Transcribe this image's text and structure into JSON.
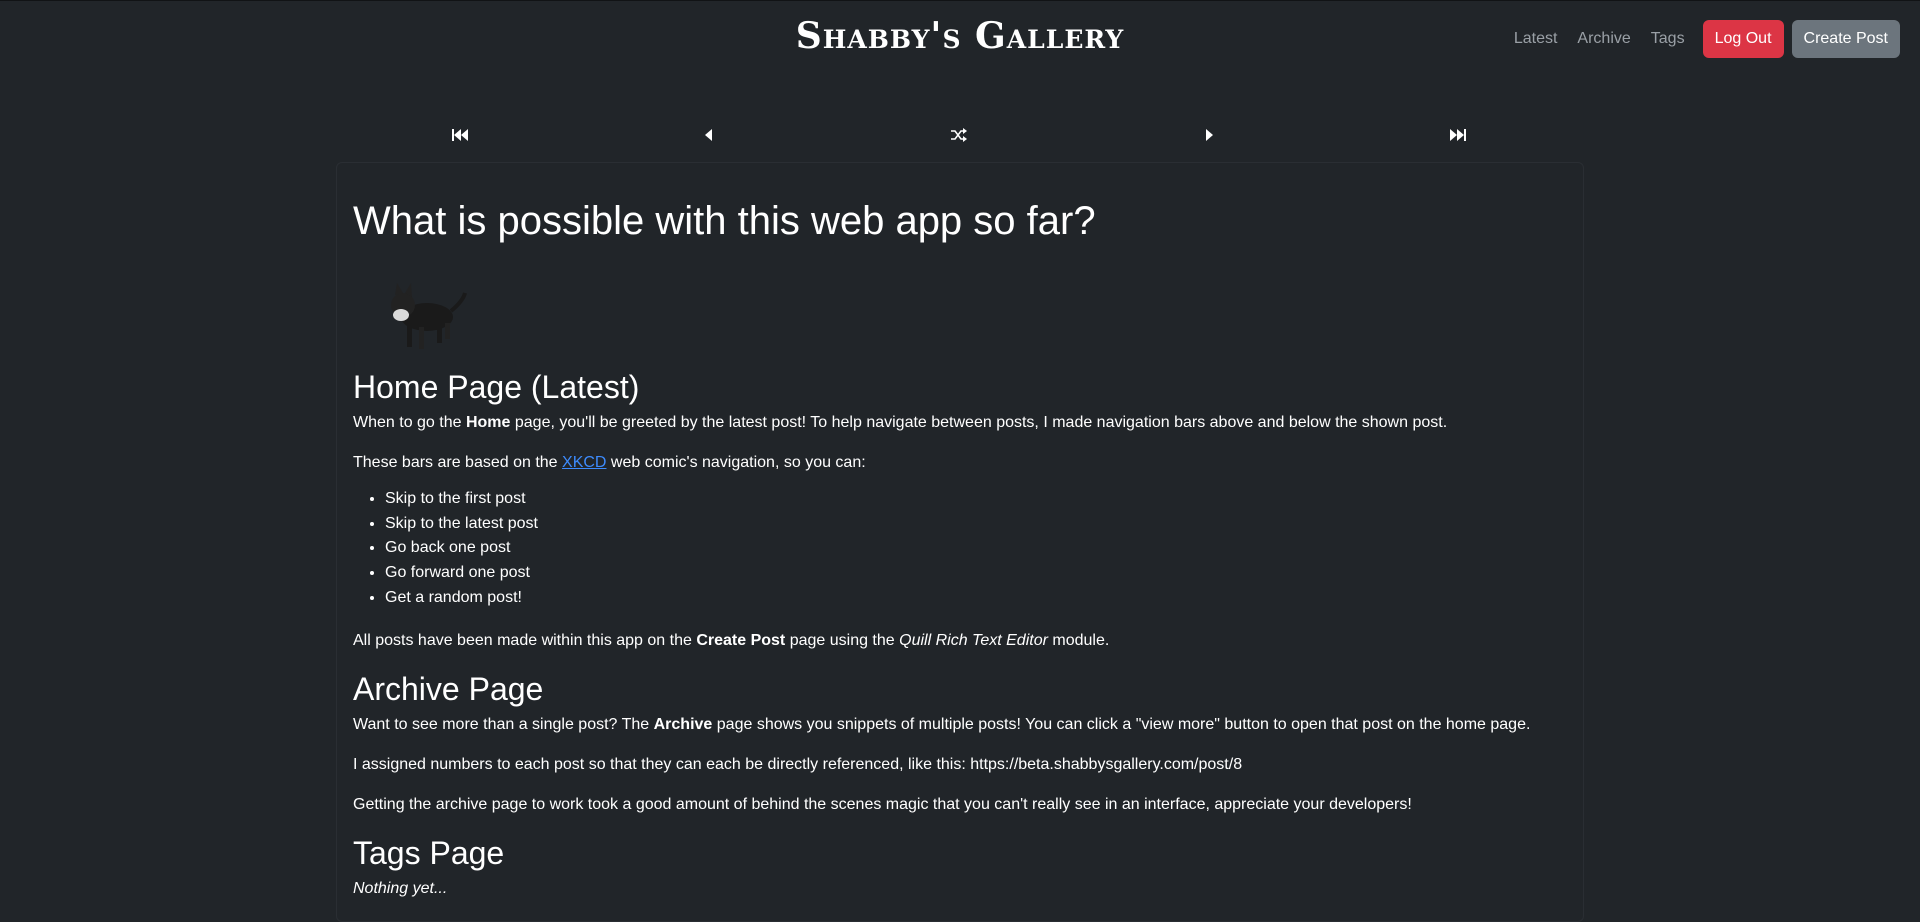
{
  "header": {
    "brand": "Shabby's Gallery",
    "nav": {
      "latest": "Latest",
      "archive": "Archive",
      "tags": "Tags",
      "logout": "Log Out",
      "create_post": "Create Post"
    }
  },
  "post_navigation": {
    "icons": [
      "skip-to-first-icon",
      "previous-icon",
      "random-icon",
      "next-icon",
      "skip-to-latest-icon"
    ]
  },
  "post": {
    "title": "What is possible with this web app so far?",
    "sections": {
      "home": {
        "heading": "Home Page (Latest)",
        "p1_a": "When to go the ",
        "p1_b": "Home",
        "p1_c": " page, you'll be greeted by the latest post! To help navigate between posts, I made navigation bars above and below the shown post.",
        "p2_a": "These bars are based on the ",
        "p2_link": "XKCD",
        "p2_c": " web comic's navigation, so you can:",
        "list": [
          "Skip to the first post",
          "Skip to the latest post",
          "Go back one post",
          "Go forward one post",
          "Get a random post!"
        ],
        "p3_a": "All posts have been made within this app on the ",
        "p3_b": "Create Post",
        "p3_c": " page using the ",
        "p3_d": "Quill Rich Text Editor",
        "p3_e": " module."
      },
      "archive": {
        "heading": "Archive Page",
        "p1_a": "Want to see more than a single post? The ",
        "p1_b": "Archive",
        "p1_c": " page shows you snippets of multiple posts! You can click a \"view more\" button to open that post on the home page.",
        "p2": "I assigned numbers to each post so that they can each be directly referenced, like this: https://beta.shabbysgallery.com/post/8",
        "p3": "Getting the archive page to work took a good amount of behind the scenes magic that you can't really see in an interface, appreciate your developers!"
      },
      "tags": {
        "heading": "Tags Page",
        "p1": "Nothing yet..."
      }
    }
  },
  "colors": {
    "background": "#212529",
    "danger": "#dc3545",
    "secondary": "#6c757d",
    "link": "#3d8bfd",
    "muted_nav": "#9aa0a6"
  }
}
